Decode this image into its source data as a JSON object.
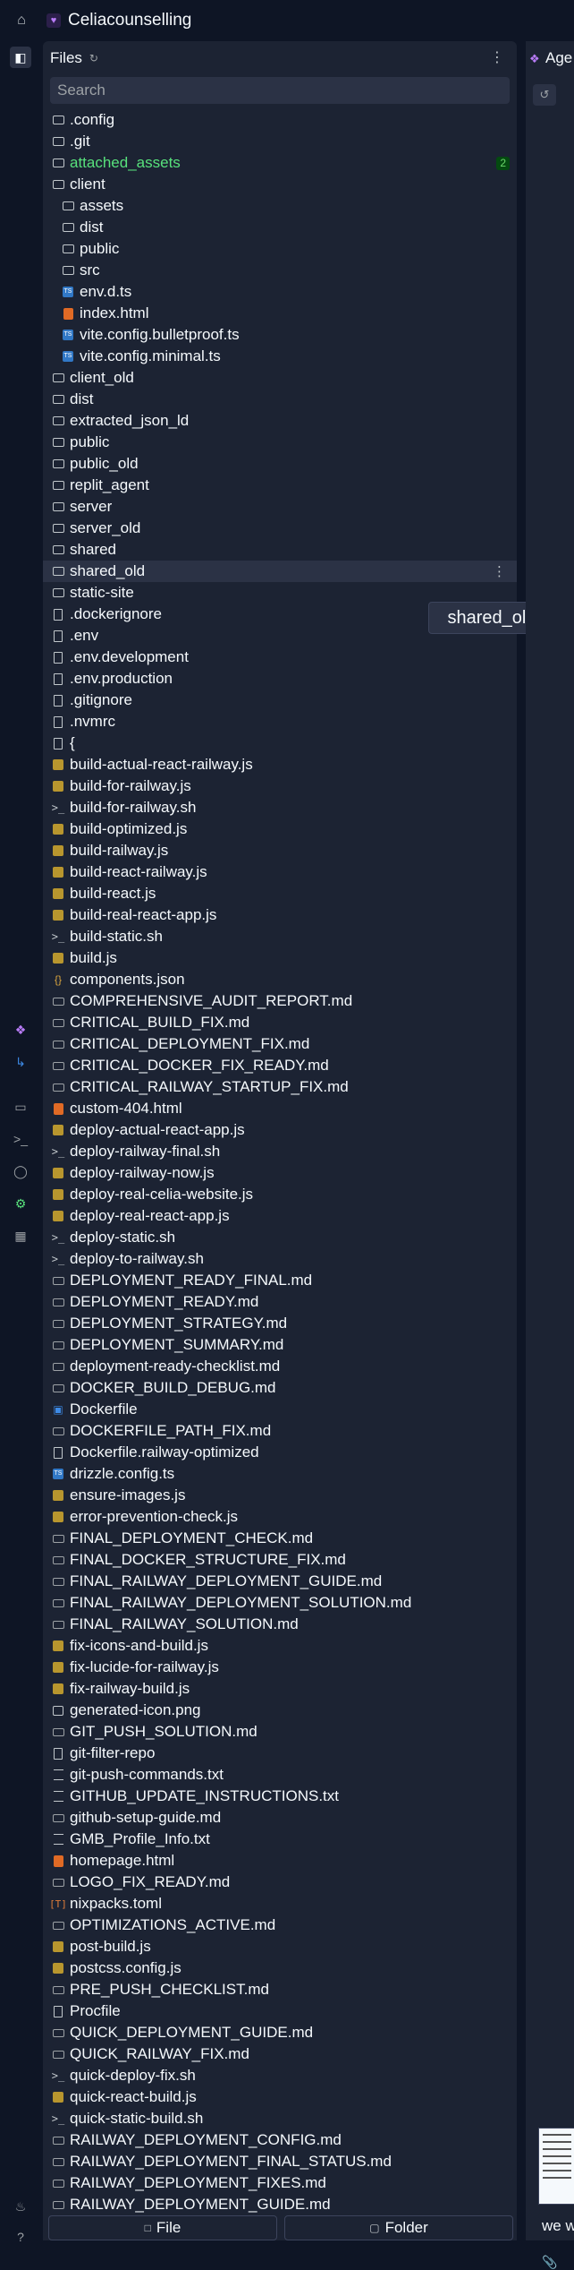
{
  "app": {
    "title": "Celiacounselling"
  },
  "files_panel": {
    "title": "Files",
    "search_placeholder": "Search",
    "tooltip": "shared_old",
    "attached_assets_badge": "2",
    "items": [
      {
        "name": ".config",
        "type": "folder",
        "indent": 0
      },
      {
        "name": ".git",
        "type": "folder",
        "indent": 0
      },
      {
        "name": "attached_assets",
        "type": "folder",
        "indent": 0
      },
      {
        "name": "client",
        "type": "folder-open",
        "indent": 0
      },
      {
        "name": "assets",
        "type": "folder",
        "indent": 1
      },
      {
        "name": "dist",
        "type": "folder",
        "indent": 1
      },
      {
        "name": "public",
        "type": "folder",
        "indent": 1
      },
      {
        "name": "src",
        "type": "folder",
        "indent": 1
      },
      {
        "name": "env.d.ts",
        "type": "ts",
        "indent": 1
      },
      {
        "name": "index.html",
        "type": "html",
        "indent": 1
      },
      {
        "name": "vite.config.bulletproof.ts",
        "type": "ts",
        "indent": 1
      },
      {
        "name": "vite.config.minimal.ts",
        "type": "ts",
        "indent": 1
      },
      {
        "name": "client_old",
        "type": "folder",
        "indent": 0
      },
      {
        "name": "dist",
        "type": "folder",
        "indent": 0
      },
      {
        "name": "extracted_json_ld",
        "type": "folder",
        "indent": 0
      },
      {
        "name": "public",
        "type": "folder",
        "indent": 0
      },
      {
        "name": "public_old",
        "type": "folder",
        "indent": 0
      },
      {
        "name": "replit_agent",
        "type": "folder",
        "indent": 0
      },
      {
        "name": "server",
        "type": "folder",
        "indent": 0
      },
      {
        "name": "server_old",
        "type": "folder",
        "indent": 0
      },
      {
        "name": "shared",
        "type": "folder",
        "indent": 0
      },
      {
        "name": "shared_old",
        "type": "folder",
        "indent": 0
      },
      {
        "name": "static-site",
        "type": "folder",
        "indent": 0
      },
      {
        "name": ".dockerignore",
        "type": "file",
        "indent": 0
      },
      {
        "name": ".env",
        "type": "file",
        "indent": 0
      },
      {
        "name": ".env.development",
        "type": "file",
        "indent": 0
      },
      {
        "name": ".env.production",
        "type": "file",
        "indent": 0
      },
      {
        "name": ".gitignore",
        "type": "file",
        "indent": 0
      },
      {
        "name": ".nvmrc",
        "type": "file",
        "indent": 0
      },
      {
        "name": "{",
        "type": "file",
        "indent": 0
      },
      {
        "name": "build-actual-react-railway.js",
        "type": "js",
        "indent": 0
      },
      {
        "name": "build-for-railway.js",
        "type": "js",
        "indent": 0
      },
      {
        "name": "build-for-railway.sh",
        "type": "sh",
        "indent": 0
      },
      {
        "name": "build-optimized.js",
        "type": "js",
        "indent": 0
      },
      {
        "name": "build-railway.js",
        "type": "js",
        "indent": 0
      },
      {
        "name": "build-react-railway.js",
        "type": "js",
        "indent": 0
      },
      {
        "name": "build-react.js",
        "type": "js",
        "indent": 0
      },
      {
        "name": "build-real-react-app.js",
        "type": "js",
        "indent": 0
      },
      {
        "name": "build-static.sh",
        "type": "sh",
        "indent": 0
      },
      {
        "name": "build.js",
        "type": "js",
        "indent": 0
      },
      {
        "name": "components.json",
        "type": "json",
        "indent": 0
      },
      {
        "name": "COMPREHENSIVE_AUDIT_REPORT.md",
        "type": "md",
        "indent": 0
      },
      {
        "name": "CRITICAL_BUILD_FIX.md",
        "type": "md",
        "indent": 0
      },
      {
        "name": "CRITICAL_DEPLOYMENT_FIX.md",
        "type": "md",
        "indent": 0
      },
      {
        "name": "CRITICAL_DOCKER_FIX_READY.md",
        "type": "md",
        "indent": 0
      },
      {
        "name": "CRITICAL_RAILWAY_STARTUP_FIX.md",
        "type": "md",
        "indent": 0
      },
      {
        "name": "custom-404.html",
        "type": "html",
        "indent": 0
      },
      {
        "name": "deploy-actual-react-app.js",
        "type": "js",
        "indent": 0
      },
      {
        "name": "deploy-railway-final.sh",
        "type": "sh",
        "indent": 0
      },
      {
        "name": "deploy-railway-now.js",
        "type": "js",
        "indent": 0
      },
      {
        "name": "deploy-real-celia-website.js",
        "type": "js",
        "indent": 0
      },
      {
        "name": "deploy-real-react-app.js",
        "type": "js",
        "indent": 0
      },
      {
        "name": "deploy-static.sh",
        "type": "sh",
        "indent": 0
      },
      {
        "name": "deploy-to-railway.sh",
        "type": "sh",
        "indent": 0
      },
      {
        "name": "DEPLOYMENT_READY_FINAL.md",
        "type": "md",
        "indent": 0
      },
      {
        "name": "DEPLOYMENT_READY.md",
        "type": "md",
        "indent": 0
      },
      {
        "name": "DEPLOYMENT_STRATEGY.md",
        "type": "md",
        "indent": 0
      },
      {
        "name": "DEPLOYMENT_SUMMARY.md",
        "type": "md",
        "indent": 0
      },
      {
        "name": "deployment-ready-checklist.md",
        "type": "md",
        "indent": 0
      },
      {
        "name": "DOCKER_BUILD_DEBUG.md",
        "type": "md",
        "indent": 0
      },
      {
        "name": "Dockerfile",
        "type": "docker",
        "indent": 0
      },
      {
        "name": "DOCKERFILE_PATH_FIX.md",
        "type": "md",
        "indent": 0
      },
      {
        "name": "Dockerfile.railway-optimized",
        "type": "file",
        "indent": 0
      },
      {
        "name": "drizzle.config.ts",
        "type": "ts",
        "indent": 0
      },
      {
        "name": "ensure-images.js",
        "type": "js",
        "indent": 0
      },
      {
        "name": "error-prevention-check.js",
        "type": "js",
        "indent": 0
      },
      {
        "name": "FINAL_DEPLOYMENT_CHECK.md",
        "type": "md",
        "indent": 0
      },
      {
        "name": "FINAL_DOCKER_STRUCTURE_FIX.md",
        "type": "md",
        "indent": 0
      },
      {
        "name": "FINAL_RAILWAY_DEPLOYMENT_GUIDE.md",
        "type": "md",
        "indent": 0
      },
      {
        "name": "FINAL_RAILWAY_DEPLOYMENT_SOLUTION.md",
        "type": "md",
        "indent": 0
      },
      {
        "name": "FINAL_RAILWAY_SOLUTION.md",
        "type": "md",
        "indent": 0
      },
      {
        "name": "fix-icons-and-build.js",
        "type": "js",
        "indent": 0
      },
      {
        "name": "fix-lucide-for-railway.js",
        "type": "js",
        "indent": 0
      },
      {
        "name": "fix-railway-build.js",
        "type": "js",
        "indent": 0
      },
      {
        "name": "generated-icon.png",
        "type": "img",
        "indent": 0
      },
      {
        "name": "GIT_PUSH_SOLUTION.md",
        "type": "md",
        "indent": 0
      },
      {
        "name": "git-filter-repo",
        "type": "file",
        "indent": 0
      },
      {
        "name": "git-push-commands.txt",
        "type": "txt",
        "indent": 0
      },
      {
        "name": "GITHUB_UPDATE_INSTRUCTIONS.txt",
        "type": "txt",
        "indent": 0
      },
      {
        "name": "github-setup-guide.md",
        "type": "md",
        "indent": 0
      },
      {
        "name": "GMB_Profile_Info.txt",
        "type": "txt",
        "indent": 0
      },
      {
        "name": "homepage.html",
        "type": "html",
        "indent": 0
      },
      {
        "name": "LOGO_FIX_READY.md",
        "type": "md",
        "indent": 0
      },
      {
        "name": "nixpacks.toml",
        "type": "toml",
        "indent": 0
      },
      {
        "name": "OPTIMIZATIONS_ACTIVE.md",
        "type": "md",
        "indent": 0
      },
      {
        "name": "post-build.js",
        "type": "js",
        "indent": 0
      },
      {
        "name": "postcss.config.js",
        "type": "js",
        "indent": 0
      },
      {
        "name": "PRE_PUSH_CHECKLIST.md",
        "type": "md",
        "indent": 0
      },
      {
        "name": "Procfile",
        "type": "file",
        "indent": 0
      },
      {
        "name": "QUICK_DEPLOYMENT_GUIDE.md",
        "type": "md",
        "indent": 0
      },
      {
        "name": "QUICK_RAILWAY_FIX.md",
        "type": "md",
        "indent": 0
      },
      {
        "name": "quick-deploy-fix.sh",
        "type": "sh",
        "indent": 0
      },
      {
        "name": "quick-react-build.js",
        "type": "js",
        "indent": 0
      },
      {
        "name": "quick-static-build.sh",
        "type": "sh",
        "indent": 0
      },
      {
        "name": "RAILWAY_DEPLOYMENT_CONFIG.md",
        "type": "md",
        "indent": 0
      },
      {
        "name": "RAILWAY_DEPLOYMENT_FINAL_STATUS.md",
        "type": "md",
        "indent": 0
      },
      {
        "name": "RAILWAY_DEPLOYMENT_FIXES.md",
        "type": "md",
        "indent": 0
      },
      {
        "name": "RAILWAY_DEPLOYMENT_GUIDE.md",
        "type": "md",
        "indent": 0
      }
    ]
  },
  "bottom_buttons": {
    "file_label": "File",
    "folder_label": "Folder"
  },
  "right_panel": {
    "tab_label": "Age",
    "message_snippet": "we w"
  },
  "colors": {
    "bg": "#0e1525",
    "panel": "#1c2333",
    "accent_green": "#58e17c",
    "accent_purple": "#b97cf8"
  }
}
